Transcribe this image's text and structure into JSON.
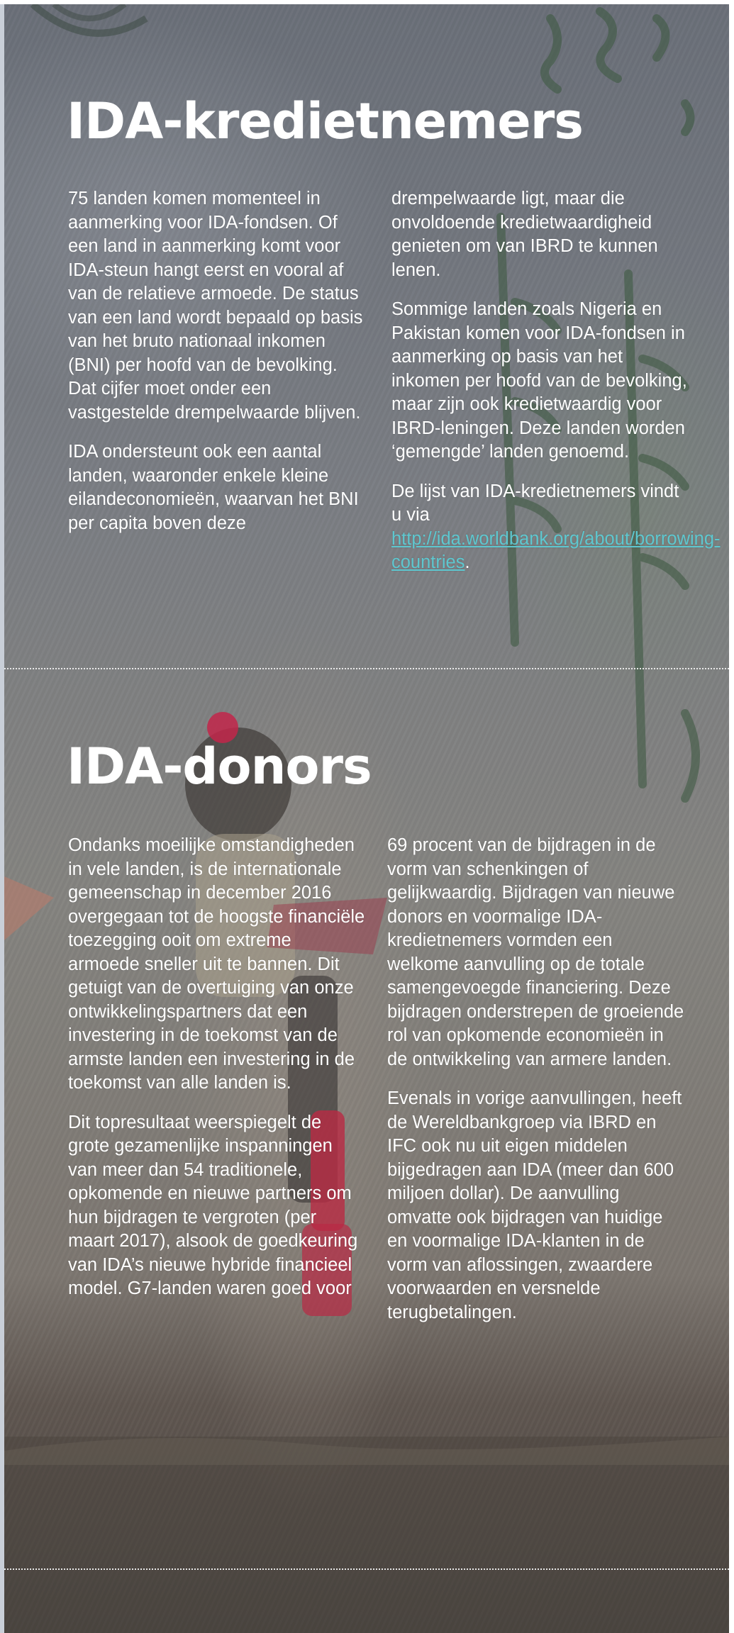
{
  "borrowers": {
    "title": "IDA-kredietnemers",
    "col1": {
      "p1": "75 landen komen momenteel in aanmerking voor IDA-fondsen. Of een land in aanmerking komt voor IDA-steun hangt eerst en vooral af van de relatieve armoede. De status van een land wordt bepaald op basis van het bruto nationaal inkomen (BNI) per hoofd van de bevolking. Dat cijfer moet onder een vastgestelde drempelwaarde blijven.",
      "p2": "IDA ondersteunt ook een aantal landen, waaronder enkele kleine eilandeconomieën, waarvan het BNI per capita boven deze"
    },
    "col2": {
      "p1": "drempelwaarde ligt, maar die onvoldoende kredietwaardigheid genieten om van IBRD te kunnen lenen.",
      "p2": "Sommige landen zoals Nigeria en Pakistan komen voor IDA-fondsen in aanmerking op basis van het inkomen per hoofd van de bevolking, maar zijn ook kredietwaardig voor IBRD-leningen. Deze landen worden ‘gemengde’ landen genoemd.",
      "p3_text": "De lijst van IDA-kredietnemers vindt u via ",
      "p3_link": "http://ida.worldbank.org/about/borrowing-countries",
      "p3_end": "."
    }
  },
  "donors": {
    "title": "IDA-donors",
    "col1": {
      "p1": "Ondanks moeilijke omstandigheden in vele landen, is de internationale gemeenschap in december 2016 overgegaan tot de hoogste financiële toezegging ooit om extreme armoede sneller uit te bannen. Dit getuigt van de overtuiging van onze ontwikkelingspartners dat een investering in de toekomst van de armste landen een investering in de toekomst van alle landen is.",
      "p2": "Dit topresultaat weerspiegelt de grote gezamenlijke inspanningen van meer dan 54 traditionele, opkomende en nieuwe partners om hun bijdragen te vergroten (per maart 2017), alsook de goedkeuring van IDA’s nieuwe hybride financieel model. G7-landen waren goed voor"
    },
    "col2": {
      "p1": "69 procent van de bijdragen in de vorm van schenkingen of gelijkwaardig. Bijdragen van nieuwe donors en voormalige IDA-kredietnemers vormden een welkome aanvulling op de totale samengevoegde financiering. Deze bijdragen onderstrepen de groeiende rol van opkomende economieën in de ontwikkeling van armere landen.",
      "p2": "Evenals in vorige aanvullingen, heeft de Wereldbankgroep via IBRD en IFC ook nu uit eigen middelen bijgedragen aan IDA (meer dan 600 miljoen dollar). De aanvulling omvatte ook bijdragen van huidige en voormalige IDA-klanten in de vorm van aflossingen, zwaardere voorwaarden en versnelde terugbetalingen."
    }
  }
}
